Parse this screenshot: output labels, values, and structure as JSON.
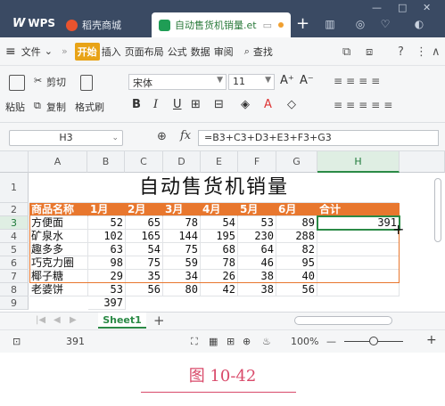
{
  "titlebar": {
    "app_name": "WPS",
    "tabs": [
      {
        "label": "稻壳商城",
        "icon": "daoke-icon"
      },
      {
        "label": "自动售货机销量.et",
        "icon": "spreadsheet-file-icon"
      }
    ],
    "add_tab": "+",
    "window_controls": [
      "—",
      "□",
      "✕"
    ]
  },
  "menubar": {
    "file": "文件",
    "more": "»",
    "start": "开始",
    "items": [
      "插入",
      "页面布局",
      "公式",
      "数据",
      "审阅"
    ],
    "find": "查找"
  },
  "ribbon": {
    "paste": "粘贴",
    "cut": "剪切",
    "copy": "复制",
    "format_painter": "格式刷",
    "font_name": "宋体",
    "font_size": "11",
    "bold": "B",
    "italic": "I",
    "underline": "U"
  },
  "formula_bar": {
    "cell_ref": "H3",
    "fx": "fx",
    "formula": "=B3+C3+D3+E3+F3+G3"
  },
  "sheet": {
    "columns": [
      "A",
      "B",
      "C",
      "D",
      "E",
      "F",
      "G",
      "H"
    ],
    "row_numbers": [
      "1",
      "2",
      "3",
      "4",
      "5",
      "6",
      "7",
      "8",
      "9"
    ],
    "title": "自动售货机销量",
    "headers": [
      "商品名称",
      "1月",
      "2月",
      "3月",
      "4月",
      "5月",
      "6月",
      "合计"
    ],
    "rows": [
      {
        "name": "方便面",
        "values": [
          "52",
          "65",
          "78",
          "54",
          "53",
          "89"
        ],
        "total": "391"
      },
      {
        "name": "矿泉水",
        "values": [
          "102",
          "165",
          "144",
          "195",
          "230",
          "288"
        ],
        "total": ""
      },
      {
        "name": "趣多多",
        "values": [
          "63",
          "54",
          "75",
          "68",
          "64",
          "82"
        ],
        "total": ""
      },
      {
        "name": "巧克力圈",
        "values": [
          "98",
          "75",
          "59",
          "78",
          "46",
          "95"
        ],
        "total": ""
      },
      {
        "name": "椰子糖",
        "values": [
          "29",
          "35",
          "34",
          "26",
          "38",
          "40"
        ],
        "total": ""
      },
      {
        "name": "老婆饼",
        "values": [
          "53",
          "56",
          "80",
          "42",
          "38",
          "56"
        ],
        "total": ""
      }
    ],
    "row9_b": "397",
    "active_cell": "H3"
  },
  "sheet_tabs": {
    "active": "Sheet1",
    "add": "+"
  },
  "statusbar": {
    "sum_value": "391",
    "zoom": "100%"
  },
  "caption": {
    "text": "图 10-42"
  },
  "colors": {
    "accent_green": "#2b8a46",
    "header_orange": "#e8772e",
    "titlebar": "#3a4a63"
  }
}
